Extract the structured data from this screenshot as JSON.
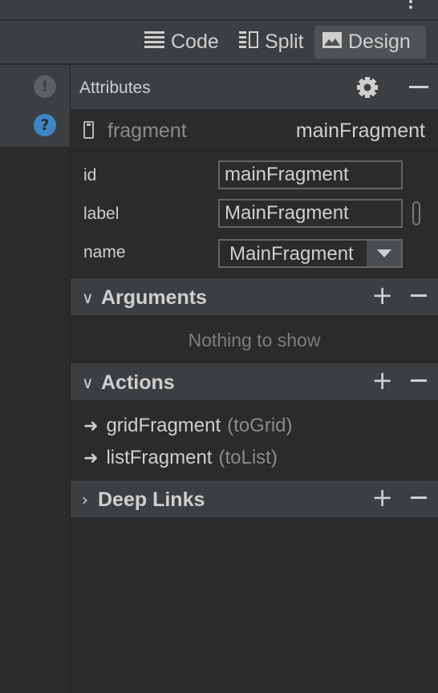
{
  "toolbar": {
    "views": [
      {
        "label": "Code",
        "icon": "code-view-icon"
      },
      {
        "label": "Split",
        "icon": "split-view-icon"
      },
      {
        "label": "Design",
        "icon": "design-view-icon",
        "active": true
      }
    ]
  },
  "panel": {
    "title": "Attributes",
    "fragment": {
      "type": "fragment",
      "name": "mainFragment"
    },
    "properties": {
      "id": {
        "label": "id",
        "value": "mainFragment"
      },
      "label": {
        "label": "label",
        "value": "MainFragment"
      },
      "name": {
        "label": "name",
        "value": "MainFragment"
      }
    }
  },
  "sections": {
    "arguments": {
      "title": "Arguments",
      "empty_text": "Nothing to show",
      "expanded": true
    },
    "actions": {
      "title": "Actions",
      "expanded": true,
      "items": [
        {
          "destination": "gridFragment",
          "id": "(toGrid)"
        },
        {
          "destination": "listFragment",
          "id": "(toList)"
        }
      ]
    },
    "deep_links": {
      "title": "Deep Links",
      "expanded": false
    }
  },
  "colors": {
    "background": "#2b2b2c",
    "header": "#3c3f41",
    "text": "#cfcfcf",
    "muted": "#8b8b8b",
    "help_accent": "#3f86c6"
  }
}
